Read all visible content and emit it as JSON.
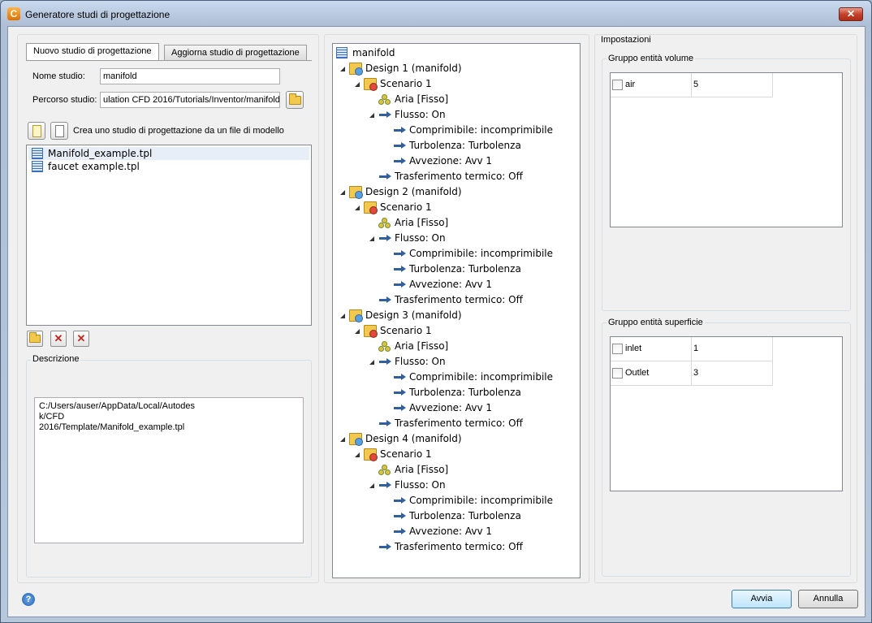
{
  "window": {
    "title": "Generatore studi di progettazione",
    "close_label": "✕"
  },
  "tabs": [
    {
      "label": "Nuovo studio di progettazione",
      "active": true
    },
    {
      "label": "Aggiorna studio di progettazione",
      "active": false
    }
  ],
  "form": {
    "name_label": "Nome studio:",
    "name_value": "manifold",
    "path_label": "Percorso studio:",
    "path_value": "ulation CFD 2016/Tutorials/Inventor/manifold",
    "create_label": "Crea uno studio di progettazione da un file di modello"
  },
  "templates": [
    {
      "label": "Manifold_example.tpl",
      "selected": true
    },
    {
      "label": "faucet example.tpl",
      "selected": false
    }
  ],
  "description": {
    "title": "Descrizione",
    "lines": [
      "C:/Users/auser/AppData/Local/Autodes",
      "k/CFD",
      "2016/Template/Manifold_example.tpl"
    ]
  },
  "tree": {
    "root": "manifold",
    "designs": [
      {
        "label": "Design 1 (manifold)"
      },
      {
        "label": "Design 2 (manifold)"
      },
      {
        "label": "Design 3 (manifold)"
      },
      {
        "label": "Design 4 (manifold)"
      }
    ],
    "scenario_label": "Scenario 1",
    "material_label": "Aria [Fisso]",
    "flow_label": "Flusso: On",
    "flow_children": [
      "Comprimibile: incomprimibile",
      "Turbolenza: Turbolenza",
      "Avvezione: Avv 1"
    ],
    "heat_label": "Trasferimento termico: Off"
  },
  "settings": {
    "title": "Impostazioni",
    "volume_group": {
      "title": "Gruppo entità volume",
      "rows": [
        {
          "name": "air",
          "value": "5"
        }
      ]
    },
    "surface_group": {
      "title": "Gruppo entità superficie",
      "rows": [
        {
          "name": "inlet",
          "value": "1"
        },
        {
          "name": "Outlet",
          "value": "3"
        }
      ]
    }
  },
  "footer": {
    "help": "?",
    "run_label": "Avvia",
    "cancel_label": "Annulla"
  },
  "icons": {
    "app": "C",
    "delete": "✕",
    "delete_all": "✕"
  }
}
